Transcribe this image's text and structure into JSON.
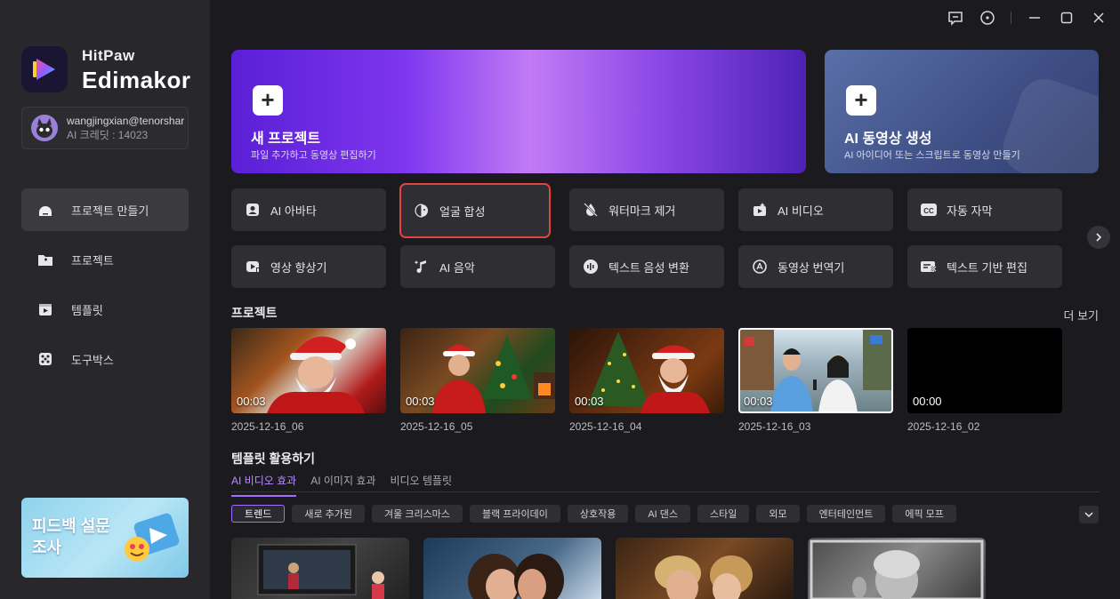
{
  "brand": {
    "line1": "HitPaw",
    "line2": "Edimakor"
  },
  "account": {
    "email": "wangjingxian@tenorshare.cn",
    "credits": "AI 크레딧 : 14023"
  },
  "nav": [
    {
      "label": "프로젝트 만들기"
    },
    {
      "label": "프로젝트"
    },
    {
      "label": "템플릿"
    },
    {
      "label": "도구박스"
    }
  ],
  "feedback": {
    "text": "피드백 설문조사"
  },
  "hero": {
    "new": {
      "title": "새 프로젝트",
      "subtitle": "파일 추가하고 동영상 편집하기"
    },
    "ai": {
      "title": "AI 동영상 생성",
      "subtitle": "AI 아이디어 또는 스크립트로 동영상 만들기"
    }
  },
  "tools": [
    {
      "label": "AI 아바타",
      "icon": "avatar-icon"
    },
    {
      "label": "얼굴 합성",
      "icon": "face-swap-icon"
    },
    {
      "label": "워터마크 제거",
      "icon": "watermark-remove-icon"
    },
    {
      "label": "AI 비디오",
      "icon": "ai-video-icon"
    },
    {
      "label": "자동 자막",
      "icon": "cc-icon"
    },
    {
      "label": "영상 향상기",
      "icon": "enhance-icon"
    },
    {
      "label": "AI 음악",
      "icon": "music-icon"
    },
    {
      "label": "텍스트 음성 변환",
      "icon": "tts-icon"
    },
    {
      "label": "동영상 번역기",
      "icon": "translate-icon"
    },
    {
      "label": "텍스트 기반 편집",
      "icon": "text-edit-icon"
    }
  ],
  "projects": {
    "title": "프로젝트",
    "more": "더 보기",
    "items": [
      {
        "duration": "00:03",
        "name": "2025-12-16_06"
      },
      {
        "duration": "00:03",
        "name": "2025-12-16_05"
      },
      {
        "duration": "00:03",
        "name": "2025-12-16_04"
      },
      {
        "duration": "00:03",
        "name": "2025-12-16_03"
      },
      {
        "duration": "00:00",
        "name": "2025-12-16_02"
      }
    ]
  },
  "templates": {
    "title": "템플릿 활용하기",
    "tabs": [
      "AI 비디오 효과",
      "AI 이미지 효과",
      "비디오 템플릿"
    ],
    "chips": [
      "트렌드",
      "새로 추가된",
      "겨울 크리스마스",
      "블랙 프라이데이",
      "상호작용",
      "AI 댄스",
      "스타일",
      "외모",
      "엔터테인먼트",
      "에픽 모프"
    ]
  },
  "colors": {
    "accent": "#a46cff",
    "highlight": "#e0443c",
    "background": "#1b1b1f",
    "sidebar": "#28282c"
  }
}
